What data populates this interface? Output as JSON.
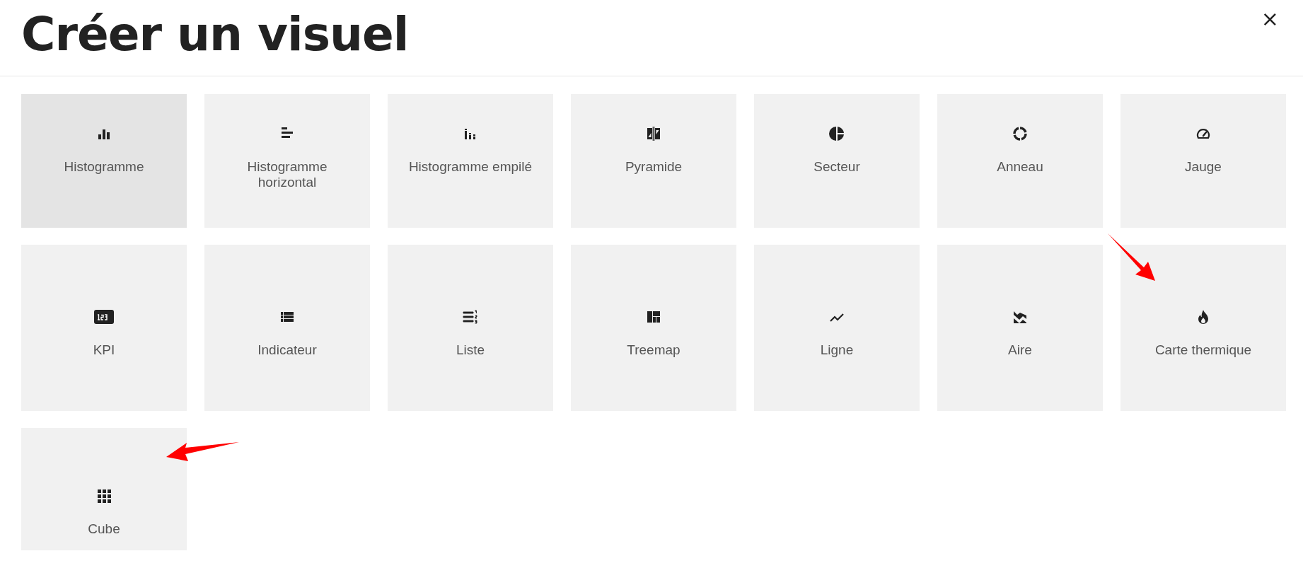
{
  "dialog": {
    "title": "Créer un visuel",
    "close": "×"
  },
  "tiles": [
    {
      "label": "Histogramme",
      "kind": "bars",
      "selected": true
    },
    {
      "label": "Histogramme horizontal",
      "kind": "hbars",
      "selected": false
    },
    {
      "label": "Histogramme empilé",
      "kind": "stacked",
      "selected": false
    },
    {
      "label": "Pyramide",
      "kind": "pyramid",
      "selected": false
    },
    {
      "label": "Secteur",
      "kind": "pie",
      "selected": false
    },
    {
      "label": "Anneau",
      "kind": "ring",
      "selected": false
    },
    {
      "label": "Jauge",
      "kind": "gauge",
      "selected": false
    },
    {
      "label": "KPI",
      "kind": "kpi",
      "selected": false
    },
    {
      "label": "Indicateur",
      "kind": "list",
      "selected": false
    },
    {
      "label": "Liste",
      "kind": "numlist",
      "selected": false
    },
    {
      "label": "Treemap",
      "kind": "treemap",
      "selected": false
    },
    {
      "label": "Ligne",
      "kind": "line",
      "selected": false
    },
    {
      "label": "Aire",
      "kind": "area",
      "selected": false
    },
    {
      "label": "Carte thermique",
      "kind": "flame",
      "selected": false
    },
    {
      "label": "Cube",
      "kind": "grid",
      "selected": false
    }
  ]
}
